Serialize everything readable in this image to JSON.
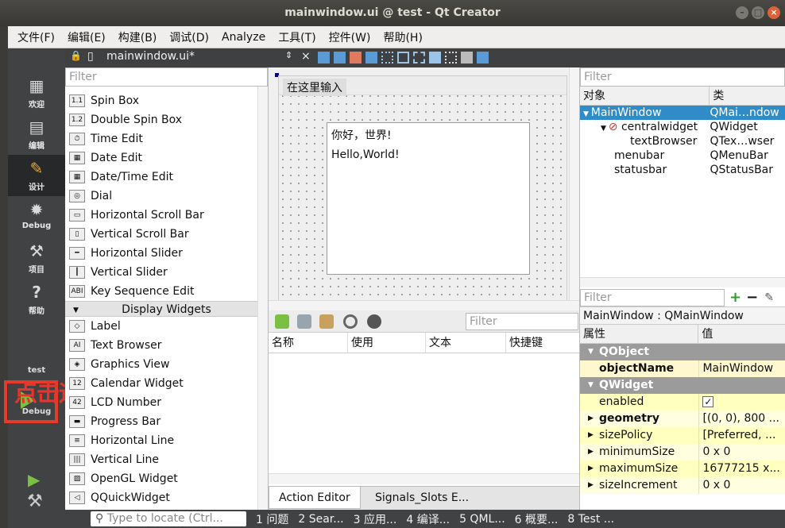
{
  "window": {
    "title": "mainwindow.ui @ test - Qt Creator"
  },
  "menubar": {
    "items": [
      "文件(F)",
      "编辑(E)",
      "构建(B)",
      "调试(D)",
      "Analyze",
      "工具(T)",
      "控件(W)",
      "帮助(H)"
    ]
  },
  "sidebar": {
    "modes": [
      {
        "label": "欢迎",
        "icon": "grid-icon"
      },
      {
        "label": "编辑",
        "icon": "edit-doc-icon"
      },
      {
        "label": "设计",
        "icon": "pencil-icon",
        "active": true
      },
      {
        "label": "Debug",
        "icon": "bug-icon"
      },
      {
        "label": "项目",
        "icon": "wrench-icon"
      },
      {
        "label": "帮助",
        "icon": "help-icon"
      }
    ],
    "target_project": "test",
    "target_mode": "Debug",
    "annotation": "点击运行"
  },
  "document": {
    "filename": "mainwindow.ui*"
  },
  "widget_box": {
    "filter_placeholder": "Filter",
    "items": [
      {
        "label": "Spin Box",
        "icon": "1.1"
      },
      {
        "label": "Double Spin Box",
        "icon": "1.2"
      },
      {
        "label": "Time Edit",
        "icon": "⏱"
      },
      {
        "label": "Date Edit",
        "icon": "▦"
      },
      {
        "label": "Date/Time Edit",
        "icon": "▦"
      },
      {
        "label": "Dial",
        "icon": "◎"
      },
      {
        "label": "Horizontal Scroll Bar",
        "icon": "▭"
      },
      {
        "label": "Vertical Scroll Bar",
        "icon": "▯"
      },
      {
        "label": "Horizontal Slider",
        "icon": "━"
      },
      {
        "label": "Vertical Slider",
        "icon": "┃"
      },
      {
        "label": "Key Sequence Edit",
        "icon": "ABI"
      }
    ],
    "category": "Display Widgets",
    "display_items": [
      {
        "label": "Label",
        "icon": "◇"
      },
      {
        "label": "Text Browser",
        "icon": "AI"
      },
      {
        "label": "Graphics View",
        "icon": "◈"
      },
      {
        "label": "Calendar Widget",
        "icon": "12"
      },
      {
        "label": "LCD Number",
        "icon": "42"
      },
      {
        "label": "Progress Bar",
        "icon": "▬"
      },
      {
        "label": "Horizontal Line",
        "icon": "≡"
      },
      {
        "label": "Vertical Line",
        "icon": "|||"
      },
      {
        "label": "OpenGL Widget",
        "icon": "▨"
      },
      {
        "label": "QQuickWidget",
        "icon": "◁"
      }
    ]
  },
  "form": {
    "menu_placeholder": "在这里输入",
    "text_line1": "你好，世界!",
    "text_line2": "Hello,World!"
  },
  "action_editor": {
    "filter_placeholder": "Filter",
    "columns": [
      "名称",
      "使用",
      "文本",
      "快捷键"
    ],
    "tabs": [
      "Action Editor",
      "Signals_Slots E..."
    ]
  },
  "object_inspector": {
    "filter_placeholder": "Filter",
    "columns": [
      "对象",
      "类"
    ],
    "rows": [
      {
        "object": "MainWindow",
        "class": "QMai…ndow",
        "selected": true
      },
      {
        "object": "centralwidget",
        "class": "QWidget"
      },
      {
        "object": "textBrowser",
        "class": "QTex…wser"
      },
      {
        "object": "menubar",
        "class": "QMenuBar"
      },
      {
        "object": "statusbar",
        "class": "QStatusBar"
      }
    ]
  },
  "property_editor": {
    "filter_placeholder": "Filter",
    "caption": "MainWindow : QMainWindow",
    "columns": [
      "属性",
      "值"
    ],
    "groups": [
      {
        "name": "QObject",
        "props": [
          {
            "name": "objectName",
            "value": "MainWindow",
            "bold": true
          }
        ]
      },
      {
        "name": "QWidget",
        "props": [
          {
            "name": "enabled",
            "value": "✓"
          },
          {
            "name": "geometry",
            "value": "[(0, 0), 800 ...",
            "bold": true
          },
          {
            "name": "sizePolicy",
            "value": "[Preferred, ..."
          },
          {
            "name": "minimumSize",
            "value": "0 x 0"
          },
          {
            "name": "maximumSize",
            "value": "16777215 x..."
          },
          {
            "name": "sizeIncrement",
            "value": "0 x 0"
          }
        ]
      }
    ]
  },
  "statusbar": {
    "locate_placeholder": "Type to locate (Ctrl...",
    "panes": [
      "1 问题",
      "2 Sear...",
      "3 应用...",
      "4 编译...",
      "5 QML...",
      "6 概要...",
      "8 Test ..."
    ]
  },
  "colors": {
    "accent": "#308cc6",
    "annotation": "#e8342a",
    "run": "#7bc043",
    "sidebar": "#404244"
  }
}
